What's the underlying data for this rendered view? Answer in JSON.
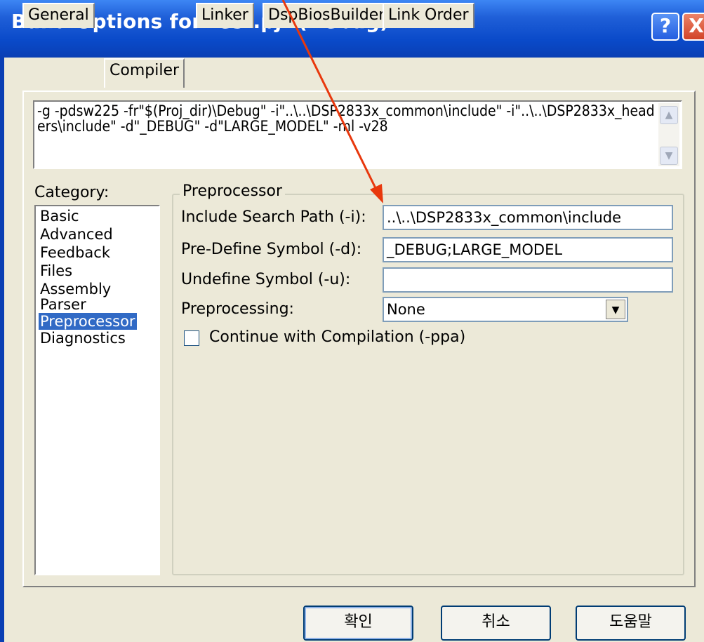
{
  "window": {
    "title": "Build Options for test.pjt (Debug)",
    "help_button": "?",
    "close_button": "X"
  },
  "tabs": [
    "General",
    "Compiler",
    "Linker",
    "DspBiosBuilder",
    "Link Order"
  ],
  "active_tab": "Compiler",
  "command_line": "-g -pdsw225 -fr\"$(Proj_dir)\\Debug\" -i\"..\\..\\DSP2833x_common\\include\" -i\"..\\..\\DSP2833x_headers\\include\" -d\"_DEBUG\" -d\"LARGE_MODEL\" -ml -v28",
  "category": {
    "label": "Category:",
    "items": [
      "Basic",
      "Advanced",
      "Feedback",
      "Files",
      "Assembly",
      "Parser",
      "Preprocessor",
      "Diagnostics"
    ],
    "selected": "Preprocessor"
  },
  "group": {
    "title": "Preprocessor",
    "include_label": "Include Search Path (-i):",
    "include_value": "..\\..\\DSP2833x_common\\include",
    "predefine_label": "Pre-Define Symbol (-d):",
    "predefine_value": "_DEBUG;LARGE_MODEL",
    "undefine_label": "Undefine Symbol (-u):",
    "undefine_value": "",
    "preprocessing_label": "Preprocessing:",
    "preprocessing_value": "None",
    "continue_label": "Continue with Compilation (-ppa)",
    "continue_checked": false
  },
  "buttons": {
    "ok": "확인",
    "cancel": "취소",
    "help": "도움말"
  },
  "colors": {
    "title_bar": "#0a4ac9",
    "dialog_bg": "#ece9d8",
    "selection": "#316ac5",
    "annotation_arrow": "#e8380d"
  }
}
